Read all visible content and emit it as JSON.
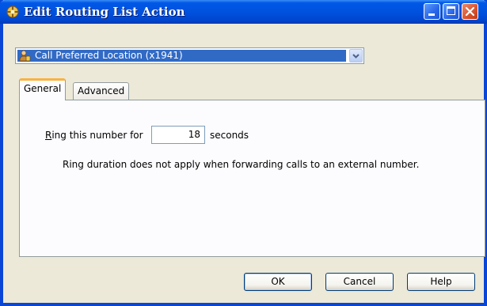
{
  "window": {
    "title": "Edit Routing List Action",
    "accent": "#0a46d6"
  },
  "titlebar_buttons": {
    "minimize": "minimize-icon",
    "maximize": "maximize-icon",
    "close": "close-icon"
  },
  "action_select": {
    "selected": "Call Preferred Location (x1941)",
    "icon": "person-phone-icon"
  },
  "tabs": [
    {
      "label": "General",
      "active": true
    },
    {
      "label": "Advanced",
      "active": false
    }
  ],
  "general": {
    "ring_label_underlined": "R",
    "ring_label_rest": "ing this number for",
    "ring_value": "18",
    "ring_unit": "seconds",
    "note": "Ring duration does not apply when forwarding calls to an external number."
  },
  "buttons": {
    "ok": "OK",
    "cancel": "Cancel",
    "help": "Help"
  }
}
